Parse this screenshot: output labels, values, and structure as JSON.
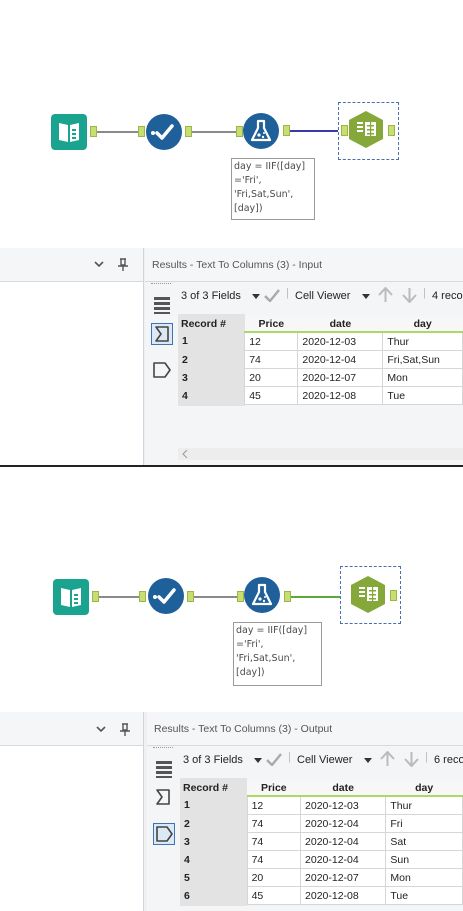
{
  "workflows": [
    {
      "annotation": "day = IIF([day]\n='Fri',\n'Fri,Sat,Sun',\n[day])",
      "results": {
        "title": "Results - Text To Columns (3) - Input",
        "fields_label": "3 of 3 Fields",
        "cell_viewer_label": "Cell Viewer",
        "record_count_label": "4 reco",
        "columns": [
          "Record #",
          "Price",
          "date",
          "day"
        ],
        "rows": [
          [
            "1",
            "12",
            "2020-12-03",
            "Thur"
          ],
          [
            "2",
            "74",
            "2020-12-04",
            "Fri,Sat,Sun"
          ],
          [
            "3",
            "20",
            "2020-12-07",
            "Mon"
          ],
          [
            "4",
            "45",
            "2020-12-08",
            "Tue"
          ]
        ],
        "active_side_button": "input"
      }
    },
    {
      "annotation": "day = IIF([day]\n='Fri',\n'Fri,Sat,Sun',\n[day])",
      "results": {
        "title": "Results - Text To Columns (3) - Output",
        "fields_label": "3 of 3 Fields",
        "cell_viewer_label": "Cell Viewer",
        "record_count_label": "6 reco",
        "columns": [
          "Record #",
          "Price",
          "date",
          "day"
        ],
        "rows": [
          [
            "1",
            "12",
            "2020-12-03",
            "Thur"
          ],
          [
            "2",
            "74",
            "2020-12-04",
            "Fri"
          ],
          [
            "3",
            "74",
            "2020-12-04",
            "Sat"
          ],
          [
            "4",
            "74",
            "2020-12-04",
            "Sun"
          ],
          [
            "5",
            "20",
            "2020-12-07",
            "Mon"
          ],
          [
            "6",
            "45",
            "2020-12-08",
            "Tue"
          ]
        ],
        "active_side_button": "output"
      }
    }
  ],
  "icons": {
    "input_tool": "book-icon",
    "select_tool": "checkmark-icon",
    "formula_tool": "flask-icon",
    "text_to_columns_tool": "text-to-columns-icon",
    "chevron": "chevron-down-icon",
    "pin": "pin-icon",
    "check": "check-icon",
    "up": "arrow-up-icon",
    "down": "arrow-down-icon",
    "table": "table-rows-icon",
    "input_anchor": "input-anchor-icon",
    "output_anchor": "output-anchor-icon"
  },
  "colors": {
    "input_tool": "#1aa38f",
    "select_tool": "#1f5f9a",
    "formula_tool": "#1f5f9a",
    "text_to_columns": "#86a83a",
    "port": "#c7de72",
    "grid_header_underline": "#a8d96a",
    "selected_wire_input": "#3a3aaa",
    "selected_wire_output": "#5aaa3a"
  }
}
